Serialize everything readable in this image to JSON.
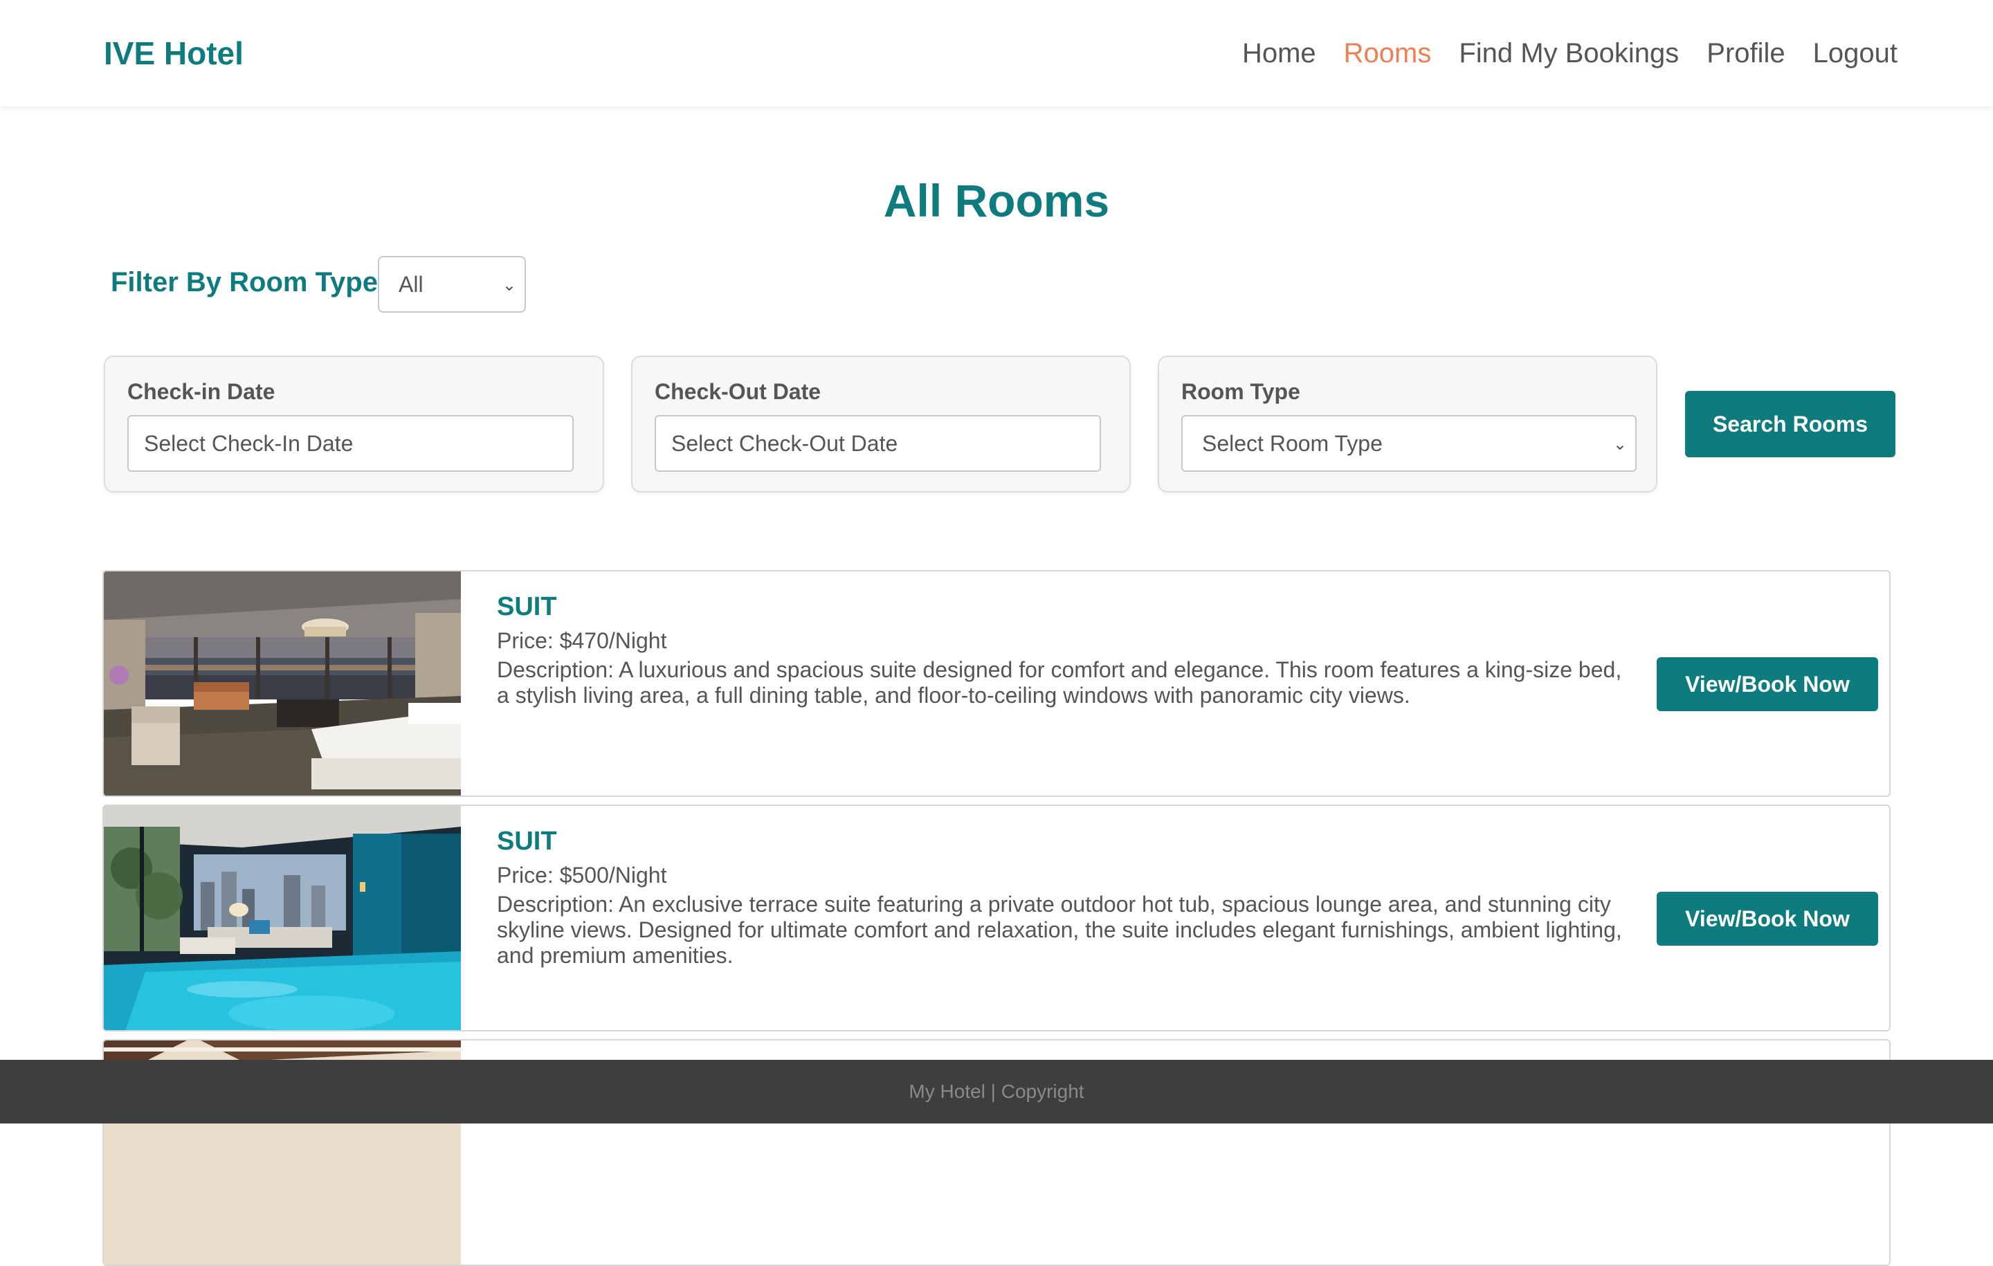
{
  "navbar": {
    "brand": "IVE Hotel",
    "links": [
      "Home",
      "Rooms",
      "Find My Bookings",
      "Profile",
      "Logout"
    ],
    "active_link": "Rooms"
  },
  "page_title": "All Rooms",
  "filter": {
    "label": "Filter By Room Type",
    "selected": "All"
  },
  "search": {
    "checkin_label": "Check-in Date",
    "checkin_placeholder": "Select Check-In Date",
    "checkout_label": "Check-Out Date",
    "checkout_placeholder": "Select Check-Out Date",
    "roomtype_label": "Room Type",
    "roomtype_selected": "Select Room Type",
    "button_label": "Search Rooms"
  },
  "rooms": [
    {
      "type": "SUIT",
      "price": "Price: $470/Night",
      "description": "Description: A luxurious and spacious suite designed for comfort and elegance. This room features a king-size bed, a stylish living area, a full dining table, and floor-to-ceiling windows with panoramic city views.",
      "button_label": "View/Book Now"
    },
    {
      "type": "SUIT",
      "price": "Price: $500/Night",
      "description": "Description: An exclusive terrace suite featuring a private outdoor hot tub, spacious lounge area, and stunning city skyline views. Designed for ultimate comfort and relaxation, the suite includes elegant furnishings, ambient lighting, and premium amenities.",
      "button_label": "View/Book Now"
    }
  ],
  "footer": {
    "text": "My Hotel | Copyright"
  },
  "colors": {
    "brand": "#0e7c7f",
    "active_nav": "#ef7e52",
    "footer_bg": "#3e3e3e"
  }
}
